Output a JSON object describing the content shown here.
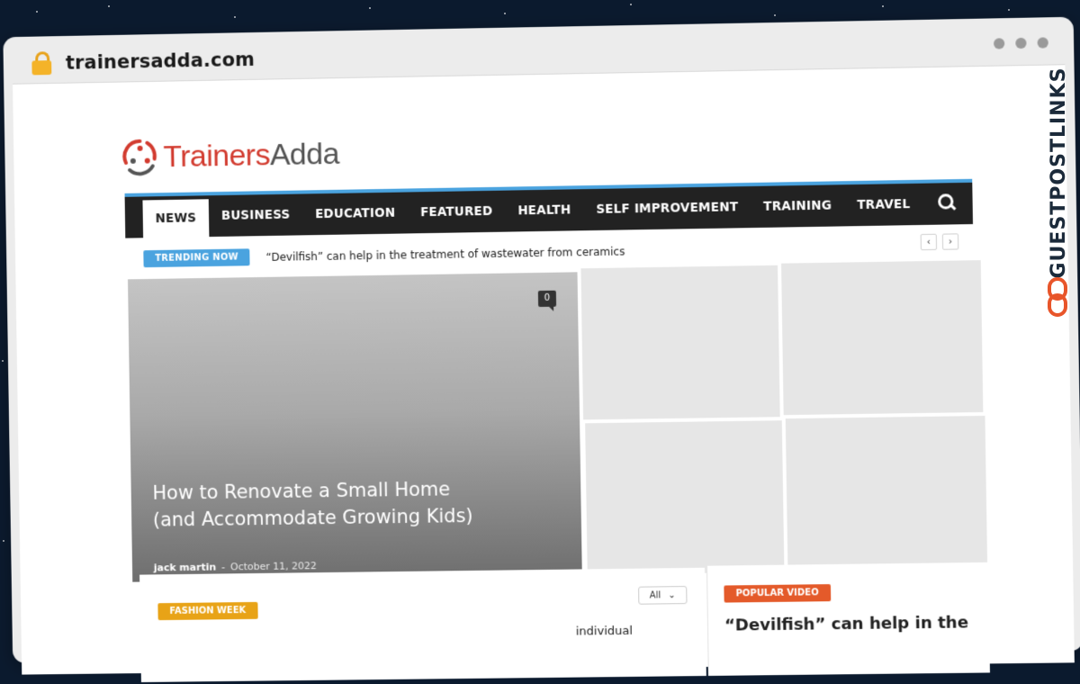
{
  "browser": {
    "url": "trainersadda.com"
  },
  "side_brand": {
    "text": "GUESTPOSTLINKS"
  },
  "site": {
    "logo": {
      "part1": "Trainers",
      "part2": "Adda"
    },
    "nav": {
      "items": [
        {
          "label": "NEWS",
          "active": true
        },
        {
          "label": "BUSINESS"
        },
        {
          "label": "EDUCATION"
        },
        {
          "label": "FEATURED"
        },
        {
          "label": "HEALTH"
        },
        {
          "label": "SELF IMPROVEMENT"
        },
        {
          "label": "TRAINING"
        },
        {
          "label": "TRAVEL"
        }
      ],
      "search_icon": "search-icon"
    },
    "trending": {
      "badge": "TRENDING NOW",
      "headline": "“Devilfish” can help in the treatment of wastewater from ceramics",
      "prev": "‹",
      "next": "›"
    },
    "featured": {
      "comments": "0",
      "title": "How to Renovate a Small Home (and Accommodate Growing Kids)",
      "author": "jack martin",
      "separator": "-",
      "date": "October 11, 2022"
    },
    "lower": {
      "left_badge": "FASHION WEEK",
      "filter_label": "All",
      "left_snippet": "individual",
      "right_badge": "POPULAR VIDEO",
      "right_snippet": "“Devilfish” can help in the"
    }
  },
  "colors": {
    "accent_blue": "#4aa3df",
    "logo_red": "#d23b2f",
    "fashion_orange": "#e8a317",
    "video_orange": "#e45a2a",
    "nav_dark": "#222222"
  }
}
